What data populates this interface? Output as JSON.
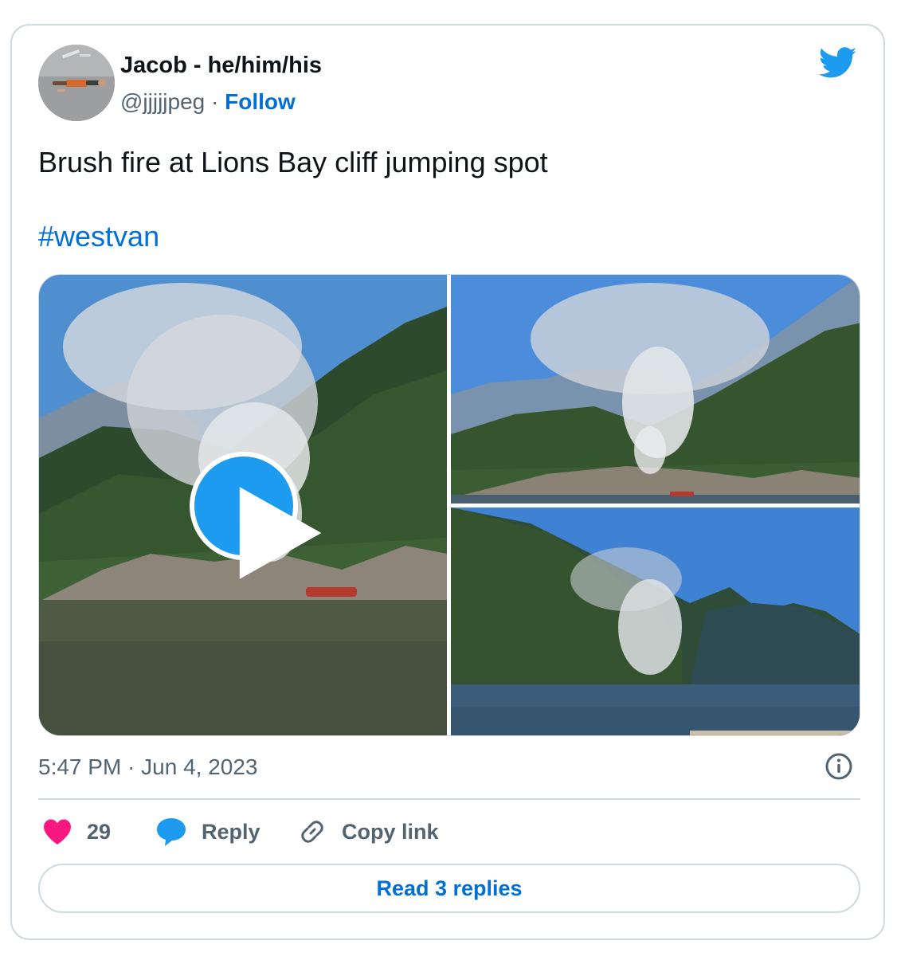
{
  "author": {
    "name": "Jacob - he/him/his",
    "handle": "@jjjjjpeg",
    "separator": "·",
    "follow_label": "Follow",
    "avatar_icon": "person-lying-on-pavement-avatar"
  },
  "brand": {
    "icon": "twitter-bird-icon",
    "color": "#1d9bf0"
  },
  "tweet": {
    "text": "Brush fire at Lions Bay cliff jumping spot",
    "hashtag": "#westvan",
    "timestamp": "5:47 PM · Jun 4, 2023"
  },
  "media": {
    "photos": [
      {
        "kind": "video",
        "icon": "play-icon"
      },
      {
        "kind": "photo"
      },
      {
        "kind": "photo"
      }
    ]
  },
  "actions": {
    "likes": {
      "count": "29",
      "icon": "heart-icon",
      "color": "#f91880"
    },
    "reply": {
      "label": "Reply",
      "icon": "speech-bubble-icon",
      "color": "#1d9bf0"
    },
    "copy_link": {
      "label": "Copy link",
      "icon": "link-icon"
    },
    "info_icon": "info-icon"
  },
  "read_replies": {
    "label": "Read 3 replies"
  },
  "colors": {
    "link": "#006fd6",
    "muted": "#536471",
    "border": "#cfd9de"
  }
}
